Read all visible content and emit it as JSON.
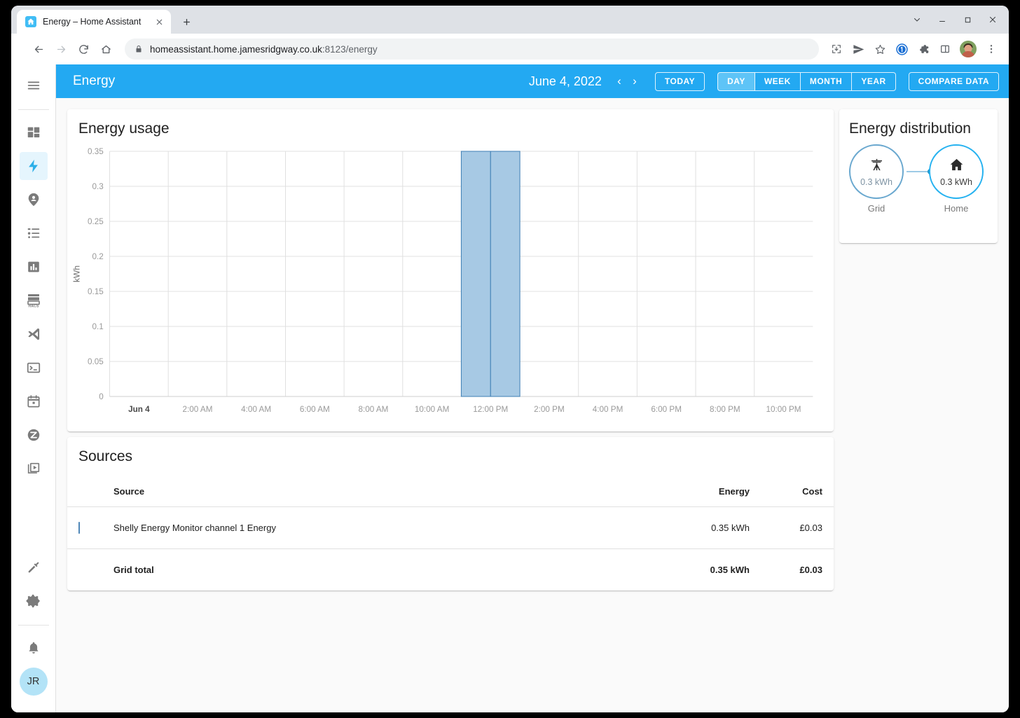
{
  "browser": {
    "tab_title": "Energy – Home Assistant",
    "new_tab_label": "+",
    "url_main": "homeassistant.home.jamesridgway.co.uk",
    "url_rest": ":8123/energy",
    "nav": {
      "back": "back-arrow",
      "forward": "forward-arrow",
      "reload": "reload",
      "home": "home"
    },
    "actions": [
      "install-icon",
      "share-icon",
      "bookmark-star-icon",
      "1password-icon",
      "extensions-icon",
      "side-panel-icon",
      "profile-avatar",
      "browser-menu-icon"
    ],
    "window_controls": [
      "chevron-down",
      "minimize",
      "maximize",
      "close"
    ]
  },
  "sidebar": {
    "menu_label": "menu",
    "items": [
      {
        "name": "overview",
        "icon": "grid-icon"
      },
      {
        "name": "energy",
        "icon": "lightning-bolt-icon",
        "active": true
      },
      {
        "name": "map",
        "icon": "map-marker-icon"
      },
      {
        "name": "logbook",
        "icon": "logbook-list-icon"
      },
      {
        "name": "history",
        "icon": "bar-chart-icon"
      },
      {
        "name": "hacs",
        "icon": "hacs-icon",
        "label": "HACS"
      },
      {
        "name": "vscode",
        "icon": "vscode-icon"
      },
      {
        "name": "terminal",
        "icon": "terminal-icon"
      },
      {
        "name": "calendar",
        "icon": "calendar-icon"
      },
      {
        "name": "zigbee",
        "icon": "zigbee-icon"
      },
      {
        "name": "media",
        "icon": "media-player-icon"
      }
    ],
    "footer": [
      {
        "name": "developer-tools",
        "icon": "hammer-icon"
      },
      {
        "name": "settings",
        "icon": "gear-icon"
      },
      {
        "name": "notifications",
        "icon": "bell-icon"
      }
    ],
    "user_initials": "JR"
  },
  "header": {
    "title": "Energy",
    "date": "June 4, 2022",
    "prev_arrow": "‹",
    "next_arrow": "›",
    "today_label": "TODAY",
    "ranges": [
      {
        "label": "DAY",
        "selected": true
      },
      {
        "label": "WEEK",
        "selected": false
      },
      {
        "label": "MONTH",
        "selected": false
      },
      {
        "label": "YEAR",
        "selected": false
      }
    ],
    "compare_label": "COMPARE DATA"
  },
  "energy_usage": {
    "title": "Energy usage"
  },
  "chart_data": {
    "type": "bar",
    "title": "Energy usage",
    "xlabel": "",
    "ylabel": "kWh",
    "ylim": [
      0,
      0.35
    ],
    "yticks": [
      "0",
      "0.05",
      "0.1",
      "0.15",
      "0.2",
      "0.25",
      "0.3",
      "0.35"
    ],
    "ytick_values": [
      0,
      0.05,
      0.1,
      0.15,
      0.2,
      0.25,
      0.3,
      0.35
    ],
    "xticks": [
      "Jun 4",
      "2:00 AM",
      "4:00 AM",
      "6:00 AM",
      "8:00 AM",
      "10:00 AM",
      "12:00 PM",
      "2:00 PM",
      "4:00 PM",
      "6:00 PM",
      "8:00 PM",
      "10:00 PM"
    ],
    "grid": true,
    "legend": "none",
    "categories": [
      "12:00 AM",
      "1:00 AM",
      "2:00 AM",
      "3:00 AM",
      "4:00 AM",
      "5:00 AM",
      "6:00 AM",
      "7:00 AM",
      "8:00 AM",
      "9:00 AM",
      "10:00 AM",
      "11:00 AM",
      "12:00 PM",
      "1:00 PM",
      "2:00 PM",
      "3:00 PM",
      "4:00 PM",
      "5:00 PM",
      "6:00 PM",
      "7:00 PM",
      "8:00 PM",
      "9:00 PM",
      "10:00 PM",
      "11:00 PM"
    ],
    "series": [
      {
        "name": "Shelly Energy Monitor channel 1 Energy",
        "color": "#a7c9e4",
        "border_color": "#3f7fb5",
        "values": [
          0,
          0,
          0,
          0,
          0,
          0,
          0,
          0,
          0,
          0,
          0,
          0,
          0.35,
          0.35,
          0,
          0,
          0,
          0,
          0,
          0,
          0,
          0,
          0,
          0
        ]
      }
    ]
  },
  "distribution": {
    "title": "Energy distribution",
    "nodes": [
      {
        "name": "grid",
        "icon": "transmission-tower-icon",
        "value": "0.3 kWh",
        "label": "Grid",
        "color": "#6aa8cf"
      },
      {
        "name": "home",
        "icon": "home-icon",
        "value": "0.3 kWh",
        "label": "Home",
        "color": "#26b2f0"
      }
    ]
  },
  "sources": {
    "title": "Sources",
    "columns": [
      "Source",
      "Energy",
      "Cost"
    ],
    "rows": [
      {
        "source": "Shelly Energy Monitor channel 1 Energy",
        "energy": "0.35 kWh",
        "cost": "£0.03",
        "swatch": "#a7c9e4"
      }
    ],
    "total": {
      "source": "Grid total",
      "energy": "0.35 kWh",
      "cost": "£0.03"
    }
  },
  "colors": {
    "accent": "#23a9f2",
    "bar_fill": "#a7c9e4",
    "bar_border": "#3f7fb5",
    "page_bg": "#fafafa"
  }
}
